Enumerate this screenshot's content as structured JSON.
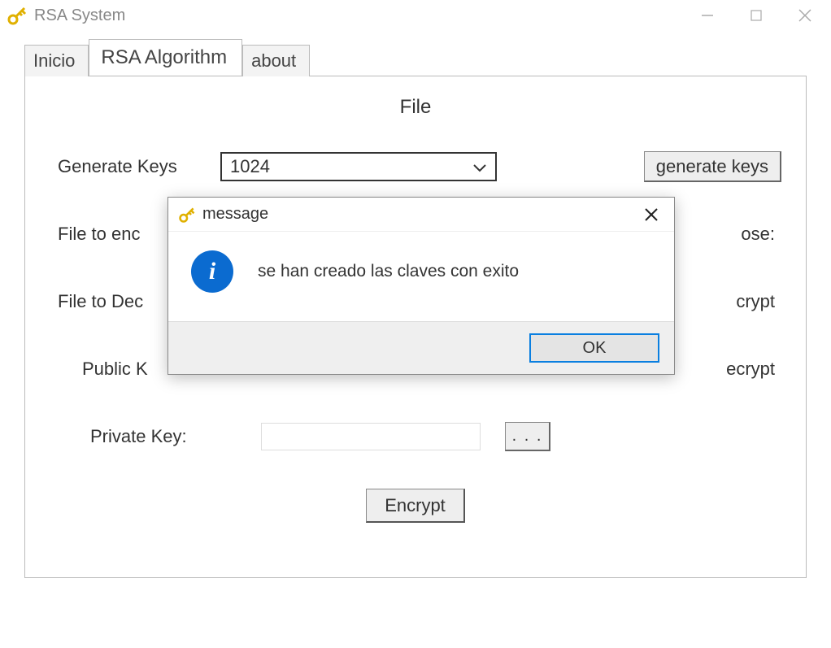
{
  "window": {
    "title": "RSA System",
    "icon": "key-icon"
  },
  "tabs": {
    "inicio": "Inicio",
    "rsa": "RSA Algorithm",
    "about": "about"
  },
  "panel": {
    "heading": "File",
    "generate_label": "Generate Keys",
    "keysize_value": "1024",
    "generate_button": "generate keys",
    "file_encrypt_label": "File to enc",
    "choose_suffix": "ose:",
    "file_decrypt_label": "File to Dec",
    "right_crypt": "crypt",
    "public_key_label": "Public K",
    "right_ecrypt": "ecrypt",
    "private_key_label": "Private Key:",
    "browse_dots": ". . .",
    "encrypt_button": "Encrypt"
  },
  "dialog": {
    "title": "message",
    "icon": "key-icon",
    "info_letter": "i",
    "message": "se han creado las claves con exito",
    "ok": "OK"
  }
}
